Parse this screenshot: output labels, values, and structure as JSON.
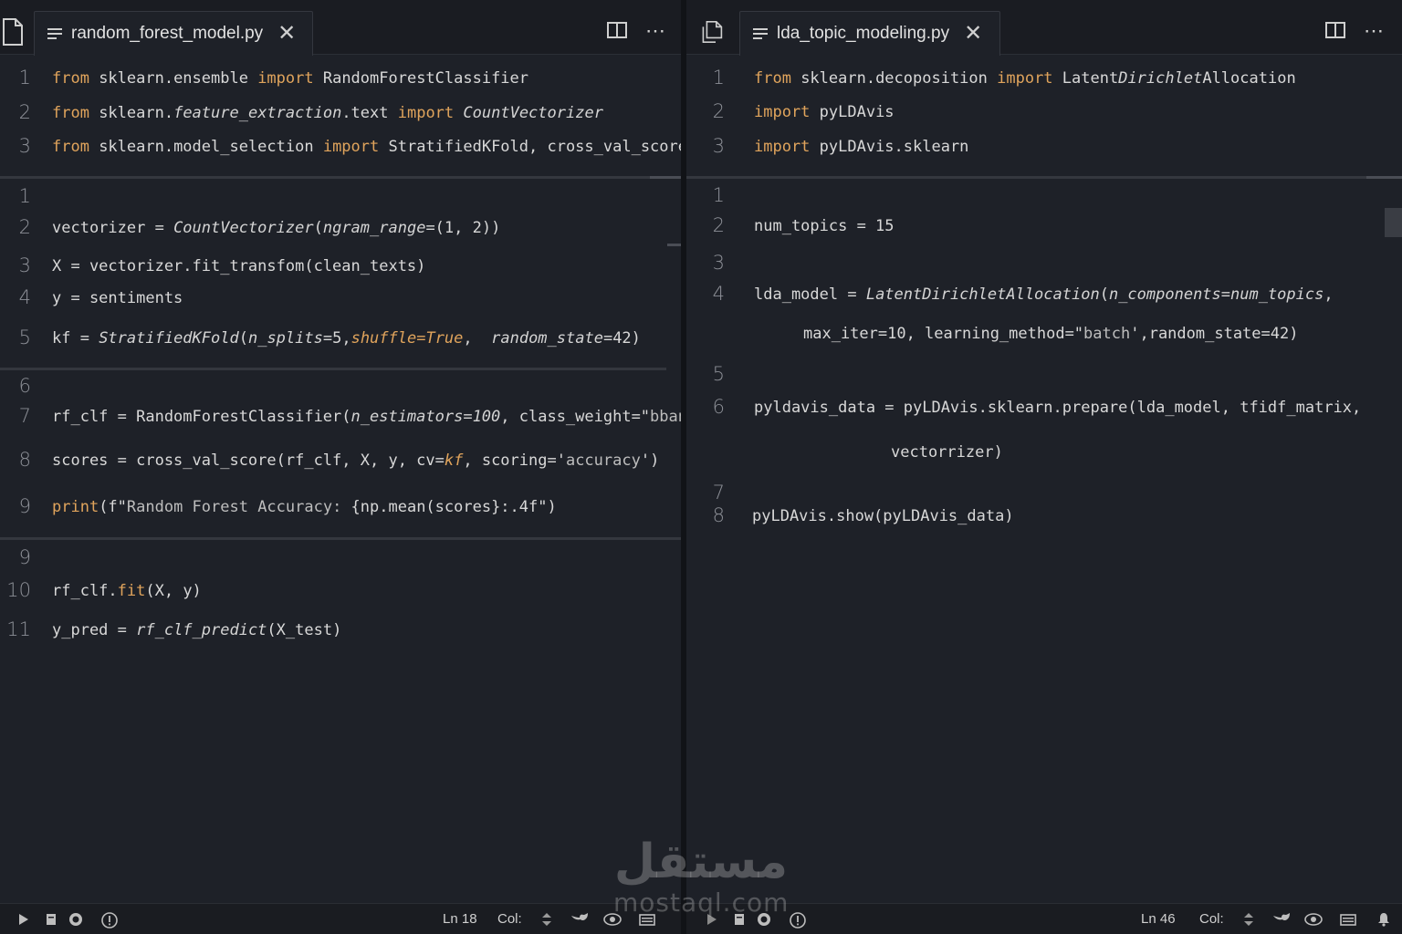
{
  "left": {
    "tab": {
      "name": "random_forest_model.py"
    },
    "status": {
      "ln": "Ln 18",
      "col": "Col:"
    },
    "lines": [
      {
        "n": "1",
        "seg": [
          [
            "kw",
            "from"
          ],
          [
            "t",
            " sklearn.ensemble "
          ],
          [
            "kw",
            "import"
          ],
          [
            "t",
            " RandomForestClassifier"
          ]
        ]
      },
      {
        "n": "2",
        "seg": [
          [
            "kw",
            "from"
          ],
          [
            "t",
            " sklearn."
          ],
          [
            "fn",
            "feature_extraction"
          ],
          [
            "t",
            ".text "
          ],
          [
            "kw",
            "import"
          ],
          [
            "t",
            " "
          ],
          [
            "fn",
            "CountVectorizer"
          ]
        ]
      },
      {
        "n": "3",
        "seg": [
          [
            "kw",
            "from"
          ],
          [
            "t",
            " sklearn.model_selection "
          ],
          [
            "kw",
            "import"
          ],
          [
            "t",
            " StratifiedKFold, cross_val_score"
          ]
        ]
      },
      {
        "n": "1",
        "seg": []
      },
      {
        "n": "2",
        "seg": [
          [
            "t",
            "vectorizer = "
          ],
          [
            "fn",
            "CountVectorizer"
          ],
          [
            "t",
            "("
          ],
          [
            "fn",
            "ngram_range"
          ],
          [
            "t",
            "=(1, 2))"
          ]
        ]
      },
      {
        "n": "3",
        "seg": [
          [
            "t",
            "X = vectorizer.fit_transfom(clean_texts)"
          ]
        ]
      },
      {
        "n": "4",
        "seg": [
          [
            "t",
            "y = sentiments"
          ]
        ]
      },
      {
        "n": "5",
        "seg": [
          [
            "t",
            "kf = "
          ],
          [
            "fn",
            "StratifiedKFold"
          ],
          [
            "t",
            "("
          ],
          [
            "fn",
            "n_splits"
          ],
          [
            "t",
            "=5,"
          ],
          [
            "kwit",
            "shuffle=True"
          ],
          [
            "t",
            ",  "
          ],
          [
            "fn",
            "random_state"
          ],
          [
            "t",
            "=42)"
          ]
        ]
      },
      {
        "n": "6",
        "seg": []
      },
      {
        "n": "7",
        "seg": [
          [
            "t",
            "rf_clf = RandomForestClassifier("
          ],
          [
            "fn",
            "n_estimators=100"
          ],
          [
            "t",
            ", class_weight=\""
          ],
          [
            "str",
            "bbanced"
          ],
          [
            "t",
            " )"
          ]
        ]
      },
      {
        "n": "8",
        "seg": [
          [
            "t",
            "scores = cross_val_score(rf_clf, X, y, cv="
          ],
          [
            "kwit",
            "kf"
          ],
          [
            "t",
            ", scoring='"
          ],
          [
            "str",
            "accuracy"
          ],
          [
            "t",
            "')"
          ]
        ]
      },
      {
        "n": "9",
        "seg": [
          [
            "kw",
            "print"
          ],
          [
            "t",
            "(f\""
          ],
          [
            "str",
            "Random Forest Accuracy: "
          ],
          [
            "t",
            "{np.mean(scores}:.4f\")"
          ]
        ]
      },
      {
        "n": "9",
        "seg": []
      },
      {
        "n": "10",
        "seg": [
          [
            "t",
            "rf_clf."
          ],
          [
            "kw",
            "fit"
          ],
          [
            "t",
            "(X, y)"
          ]
        ]
      },
      {
        "n": "11",
        "seg": [
          [
            "t",
            "y_pred = "
          ],
          [
            "fn",
            "rf_clf_predict"
          ],
          [
            "t",
            "(X_test)"
          ]
        ]
      }
    ]
  },
  "right": {
    "tab": {
      "name": "lda_topic_modeling.py"
    },
    "status": {
      "ln": "Ln 46",
      "col": "Col:"
    },
    "lines": [
      {
        "n": "1",
        "seg": [
          [
            "kw",
            "from"
          ],
          [
            "t",
            " sklearn.decoposition "
          ],
          [
            "kw",
            "import"
          ],
          [
            "t",
            " Latent"
          ],
          [
            "fn",
            "Dirichlet"
          ],
          [
            "t",
            "Allocation"
          ]
        ]
      },
      {
        "n": "2",
        "seg": [
          [
            "kw",
            "import"
          ],
          [
            "t",
            " pyLDAvis"
          ]
        ]
      },
      {
        "n": "3",
        "seg": [
          [
            "kw",
            "import"
          ],
          [
            "t",
            " pyLDAvis.sklearn"
          ]
        ]
      },
      {
        "n": "1",
        "seg": []
      },
      {
        "n": "2",
        "seg": [
          [
            "t",
            "num_topics = 15"
          ]
        ]
      },
      {
        "n": "3",
        "seg": []
      },
      {
        "n": "4",
        "seg": [
          [
            "t",
            "lda_model = "
          ],
          [
            "fn",
            "LatentDirichletAllocation"
          ],
          [
            "t",
            "("
          ],
          [
            "fn",
            "n_components=num_topics"
          ],
          [
            "t",
            ","
          ]
        ]
      },
      {
        "n": "",
        "seg": [
          [
            "t",
            "max_iter=10, learning_method=\""
          ],
          [
            "str",
            "batch"
          ],
          [
            "t",
            "',random_state=42)"
          ]
        ]
      },
      {
        "n": "5",
        "seg": []
      },
      {
        "n": "6",
        "seg": [
          [
            "t",
            "pyldavis_data = pyLDAvis.sklearn.prepare(lda_model, tfidf_matrix,"
          ]
        ]
      },
      {
        "n": "",
        "seg": [
          [
            "t",
            "vectorrizer)"
          ]
        ]
      },
      {
        "n": "7",
        "seg": []
      },
      {
        "n": "8",
        "seg": [
          [
            "t",
            "pyLDAvis.show(pyLDAvis_data)"
          ]
        ]
      }
    ]
  },
  "watermark": {
    "arabic": "مستقل",
    "latin": "mostaql.com"
  }
}
